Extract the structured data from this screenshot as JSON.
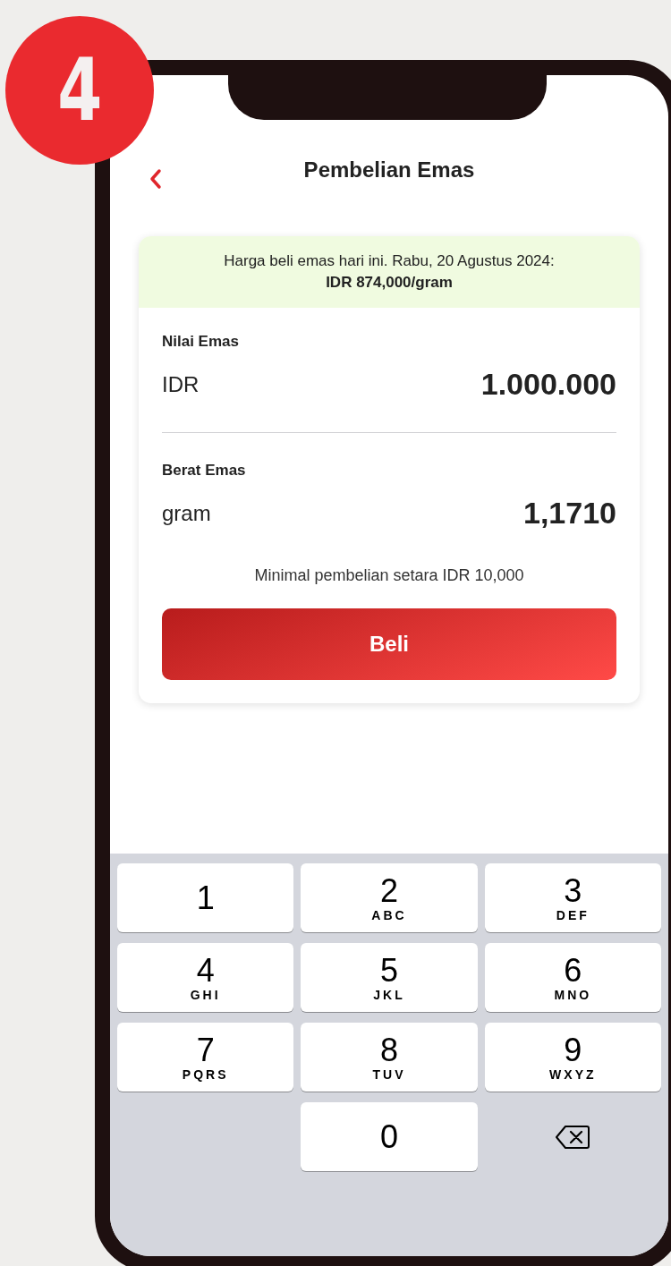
{
  "badge": "4",
  "header": {
    "title": "Pembelian Emas"
  },
  "price_banner": {
    "line1": "Harga beli emas hari ini. Rabu, 20 Agustus 2024:",
    "line2": "IDR 874,000/gram"
  },
  "fields": [
    {
      "label": "Nilai Emas",
      "unit": "IDR",
      "value": "1.000.000"
    },
    {
      "label": "Berat Emas",
      "unit": "gram",
      "value": "1,1710"
    }
  ],
  "note": "Minimal pembelian setara IDR 10,000",
  "buy_button": "Beli",
  "keypad": [
    {
      "kind": "digit",
      "digit": "1"
    },
    {
      "kind": "digit",
      "digit": "2",
      "letters": "ABC"
    },
    {
      "kind": "digit",
      "digit": "3",
      "letters": "DEF"
    },
    {
      "kind": "digit",
      "digit": "4",
      "letters": "GHI"
    },
    {
      "kind": "digit",
      "digit": "5",
      "letters": "JKL"
    },
    {
      "kind": "digit",
      "digit": "6",
      "letters": "MNO"
    },
    {
      "kind": "digit",
      "digit": "7",
      "letters": "PQRS"
    },
    {
      "kind": "digit",
      "digit": "8",
      "letters": "TUV"
    },
    {
      "kind": "digit",
      "digit": "9",
      "letters": "WXYZ"
    },
    {
      "kind": "blank"
    },
    {
      "kind": "digit",
      "digit": "0"
    },
    {
      "kind": "backspace"
    }
  ]
}
